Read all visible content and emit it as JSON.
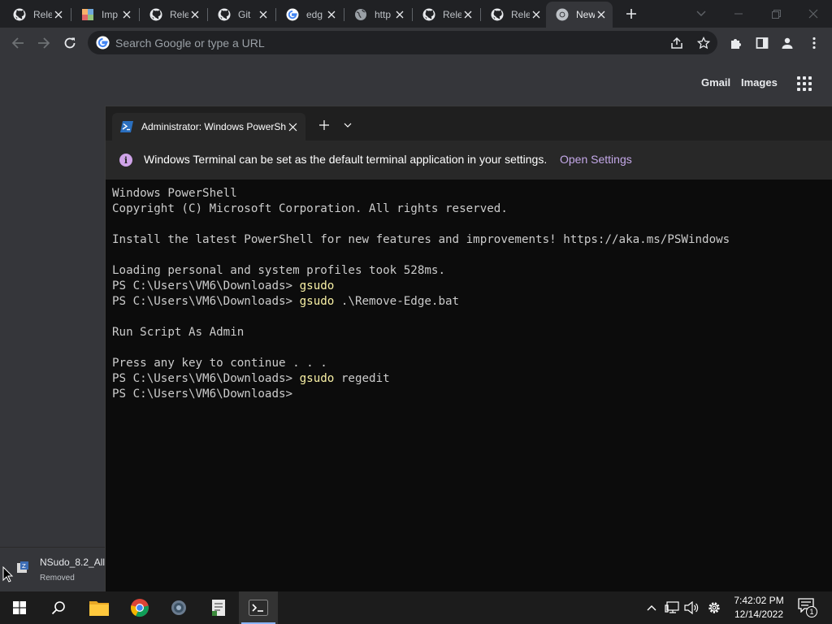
{
  "browser": {
    "tabs": [
      {
        "title": "Rele",
        "icon": "github-icon"
      },
      {
        "title": "Imp",
        "icon": "colorful-square-icon"
      },
      {
        "title": "Rele",
        "icon": "github-icon"
      },
      {
        "title": "Git",
        "icon": "github-icon"
      },
      {
        "title": "edg",
        "icon": "google-icon"
      },
      {
        "title": "http",
        "icon": "globe-icon"
      },
      {
        "title": "Rele",
        "icon": "github-icon"
      },
      {
        "title": "Rele",
        "icon": "github-icon"
      },
      {
        "title": "New",
        "icon": "chrome-icon",
        "active": true
      }
    ],
    "omnibox": {
      "placeholder": "Search Google or type a URL",
      "value": ""
    }
  },
  "newtab": {
    "gmail": "Gmail",
    "images": "Images"
  },
  "terminal": {
    "tab_title": "Administrator: Windows PowerShell",
    "infobar": {
      "message": "Windows Terminal can be set as the default terminal application in your settings.",
      "link": "Open Settings"
    },
    "lines": [
      {
        "text": "Windows PowerShell"
      },
      {
        "text": "Copyright (C) Microsoft Corporation. All rights reserved."
      },
      {
        "text": ""
      },
      {
        "text": "Install the latest PowerShell for new features and improvements! https://aka.ms/PSWindows"
      },
      {
        "text": ""
      },
      {
        "text": "Loading personal and system profiles took 528ms."
      },
      {
        "prompt": "PS C:\\Users\\VM6\\Downloads> ",
        "cmd": "gsudo",
        "args": ""
      },
      {
        "prompt": "PS C:\\Users\\VM6\\Downloads> ",
        "cmd": "gsudo",
        "args": " .\\Remove-Edge.bat"
      },
      {
        "text": ""
      },
      {
        "text": "Run Script As Admin"
      },
      {
        "text": ""
      },
      {
        "text": "Press any key to continue . . ."
      },
      {
        "prompt": "PS C:\\Users\\VM6\\Downloads> ",
        "cmd": "gsudo",
        "args": " regedit"
      },
      {
        "prompt": "PS C:\\Users\\VM6\\Downloads>",
        "cmd": "",
        "args": ""
      }
    ]
  },
  "download": {
    "filename": "NSudo_8.2_All",
    "status": "Removed"
  },
  "taskbar": {
    "time": "7:42:02 PM",
    "date": "12/14/2022",
    "notification_count": "1"
  }
}
